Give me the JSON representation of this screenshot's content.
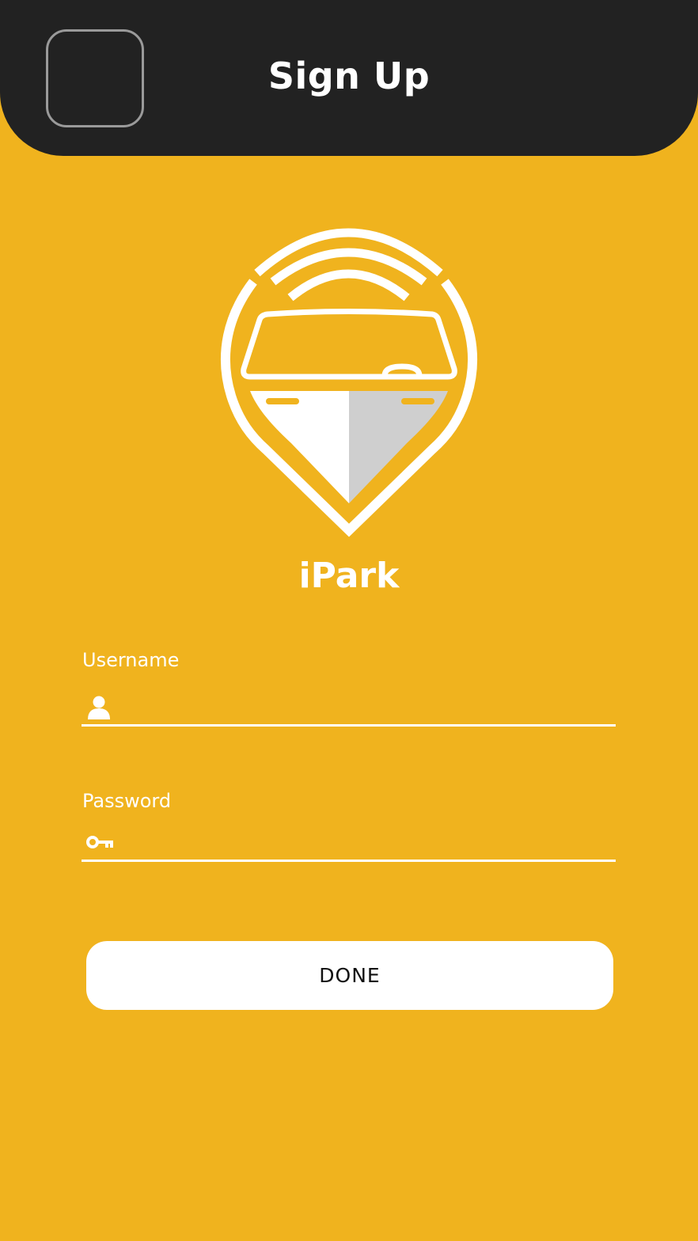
{
  "header": {
    "title": "Sign Up",
    "back_icon": "back-button-placeholder"
  },
  "brand": {
    "app_name": "iPark",
    "logo_icon": "parking-pin-car-signal-icon"
  },
  "form": {
    "username": {
      "label": "Username",
      "value": "",
      "placeholder": "",
      "icon": "user-icon"
    },
    "password": {
      "label": "Password",
      "value": "",
      "placeholder": "",
      "icon": "key-icon"
    },
    "submit_label": "DONE"
  },
  "colors": {
    "background": "#F0B31E",
    "header": "#222222",
    "foreground": "#FFFFFF",
    "logo_shade": "#CFCFCF"
  }
}
